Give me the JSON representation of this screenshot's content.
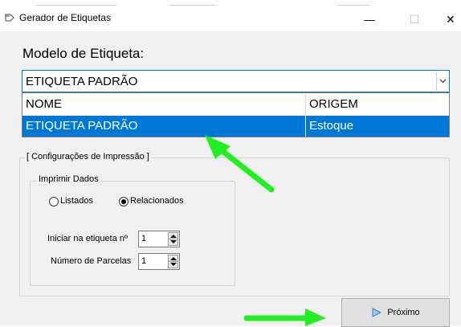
{
  "window": {
    "title": "Gerador de Etiquetas",
    "controls": {
      "minimize": "—",
      "maximize": "☐",
      "close": "✕"
    }
  },
  "modelo": {
    "label": "Modelo de Etiqueta:",
    "selected": "ETIQUETA PADRÃO",
    "dropdown": {
      "columns": [
        "NOME",
        "ORIGEM"
      ],
      "rows": [
        {
          "nome": "ETIQUETA PADRÃO",
          "origem": "Estoque",
          "selected": true
        }
      ]
    }
  },
  "impressao": {
    "group_title": "[ Configurações de Impressão ]",
    "dados_title": "Imprimir Dados",
    "radios": [
      {
        "label": "Listados",
        "checked": false
      },
      {
        "label": "Relacionados",
        "checked": true
      }
    ],
    "iniciar_label": "Iniciar na etiqueta nº",
    "iniciar_value": "1",
    "parcelas_label": "Número de Parcelas",
    "parcelas_value": "1"
  },
  "footer": {
    "next_label": "Próximo"
  },
  "colors": {
    "accent": "#0078d7",
    "annotation_arrow": "#22ee22",
    "window_bg": "#f0f0f0"
  }
}
